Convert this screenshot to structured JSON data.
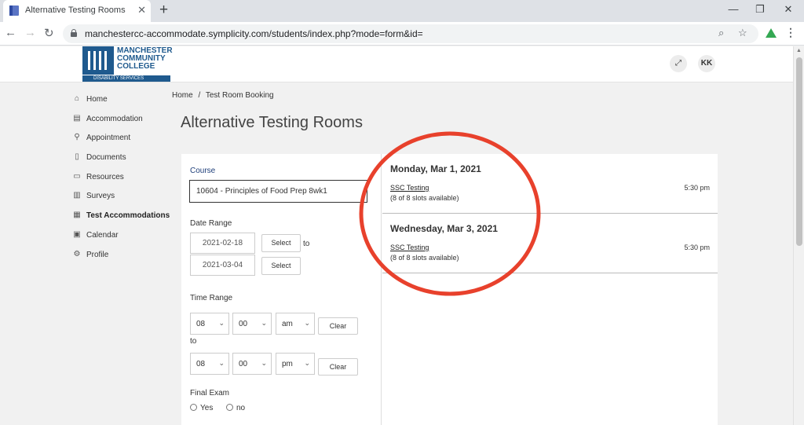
{
  "browser": {
    "tab_title": "Alternative Testing Rooms",
    "tab_close": "✕",
    "new_tab": "+",
    "url": "manchestercc-accommodate.symplicity.com/students/index.php?mode=form&id=",
    "window_controls": {
      "minimize": "—",
      "restore": "❐",
      "close": "✕"
    }
  },
  "header": {
    "logo_text": "MANCHESTER\nCOMMUNITY\nCOLLEGE",
    "logo_subtitle": "DISABILITY SERVICES",
    "user_initials": "KK",
    "brand_color": "#1f5a8e"
  },
  "sidebar": {
    "items": [
      {
        "label": "Home",
        "icon": "home-icon"
      },
      {
        "label": "Accommodation",
        "icon": "accommodation-icon"
      },
      {
        "label": "Appointment",
        "icon": "appointment-icon"
      },
      {
        "label": "Documents",
        "icon": "documents-icon"
      },
      {
        "label": "Resources",
        "icon": "resources-icon"
      },
      {
        "label": "Surveys",
        "icon": "surveys-icon"
      },
      {
        "label": "Test Accommodations",
        "icon": "test-accommodations-icon",
        "active": true
      },
      {
        "label": "Calendar",
        "icon": "calendar-icon"
      },
      {
        "label": "Profile",
        "icon": "profile-icon"
      }
    ]
  },
  "breadcrumb": {
    "home": "Home",
    "separator": "/",
    "current": "Test Room Booking"
  },
  "page_title": "Alternative Testing Rooms",
  "form": {
    "course_label": "Course",
    "course_value": "10604 - Principles of Food Prep 8wk1",
    "date_range_label": "Date Range",
    "date_from": "2021-02-18",
    "date_to": "2021-03-04",
    "select_label": "Select",
    "to_label": "to",
    "time_range_label": "Time Range",
    "start": {
      "hour": "08",
      "minute": "00",
      "ampm": "am"
    },
    "end": {
      "hour": "08",
      "minute": "00",
      "ampm": "pm"
    },
    "clear_label": "Clear",
    "final_exam_label": "Final Exam",
    "final_exam_yes": "Yes",
    "final_exam_no": "no"
  },
  "slots": [
    {
      "date": "Monday, Mar 1, 2021",
      "name": "SSC Testing",
      "availability": "(8 of 8 slots available)",
      "time": "5:30 pm"
    },
    {
      "date": "Wednesday, Mar 3, 2021",
      "name": "SSC Testing",
      "availability": "(8 of 8 slots available)",
      "time": "5:30 pm"
    }
  ],
  "annotation_color": "#e8412c"
}
